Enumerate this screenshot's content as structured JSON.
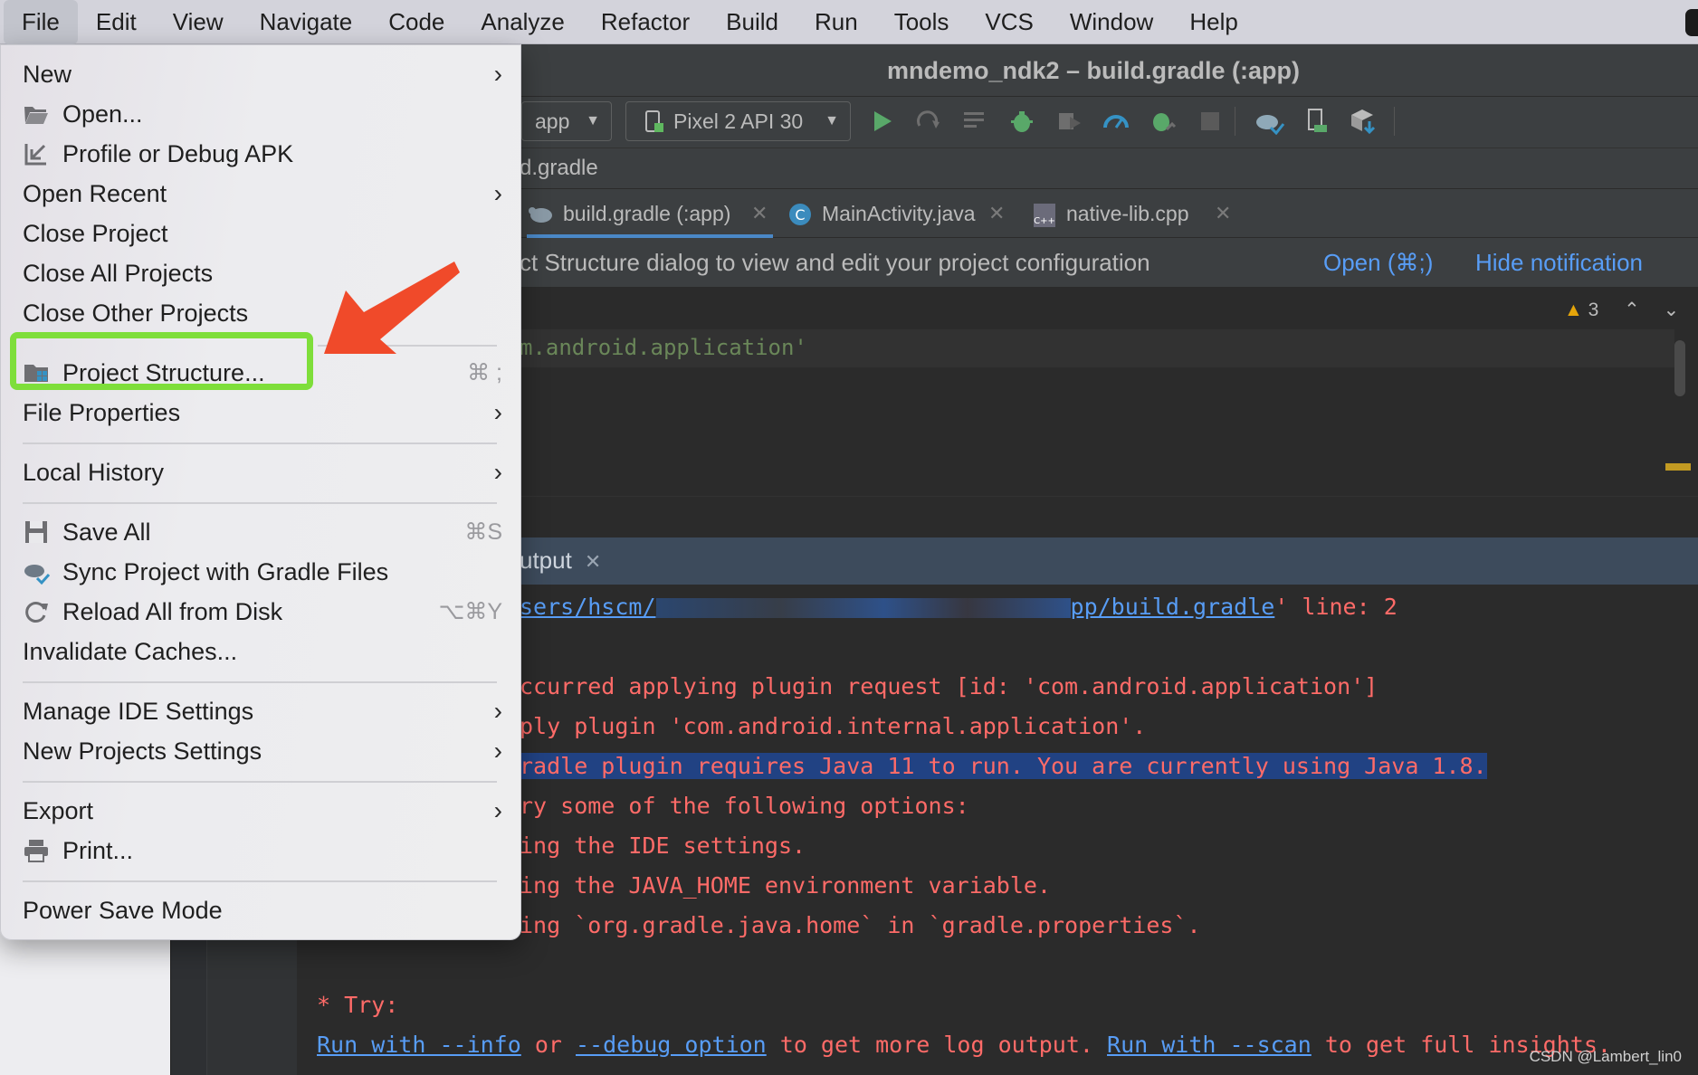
{
  "menubar": {
    "items": [
      "File",
      "Edit",
      "View",
      "Navigate",
      "Code",
      "Analyze",
      "Refactor",
      "Build",
      "Run",
      "Tools",
      "VCS",
      "Window",
      "Help"
    ]
  },
  "window": {
    "title": "mndemo_ndk2 – build.gradle (:app)"
  },
  "toolbar": {
    "module_config": "app",
    "device": "Pixel 2 API 30"
  },
  "navbar": {
    "path": "d.gradle"
  },
  "tabs": [
    {
      "label": "build.gradle (:app)",
      "active": true
    },
    {
      "label": "MainActivity.java",
      "active": false
    },
    {
      "label": "native-lib.cpp",
      "active": false
    }
  ],
  "notification": {
    "text": "ct Structure dialog to view and edit your project configuration",
    "open_link": "Open (⌘;)",
    "hide_link": "Hide notification"
  },
  "editor": {
    "code": "m.android.application'",
    "warning_count": "3"
  },
  "output": {
    "title": "utput",
    "lines": {
      "l1_link": "sers/hscm/",
      "l1_link2": "pp/build.gradle",
      "l1_tail": "' line: 2",
      "l2": "ccurred applying plugin request [id: 'com.android.application']",
      "l3": "ply plugin 'com.android.internal.application'.",
      "l4": "radle plugin requires Java 11 to run. You are currently using Java 1.8.",
      "l5": "ry some of the following options:",
      "l6": "ing the IDE settings.",
      "l7": "ing the JAVA_HOME environment variable.",
      "l8": "ing `org.gradle.java.home` in `gradle.properties`.",
      "try": "* Try:",
      "run_info": "Run with --info",
      "or": " or ",
      "debug_opt": "--debug option",
      "mid": " to get more log output. ",
      "run_scan": "Run with --scan",
      "end": " to get full insights."
    }
  },
  "watermark": "CSDN @Lambert_lin0",
  "file_menu": {
    "new": "New",
    "open": "Open...",
    "profile_debug": "Profile or Debug APK",
    "open_recent": "Open Recent",
    "close_project": "Close Project",
    "close_all": "Close All Projects",
    "close_other": "Close Other Projects",
    "project_structure": "Project Structure...",
    "project_structure_sc": "⌘ ;",
    "file_properties": "File Properties",
    "local_history": "Local History",
    "save_all": "Save All",
    "save_all_sc": "⌘S",
    "sync_gradle": "Sync Project with Gradle Files",
    "reload_disk": "Reload All from Disk",
    "reload_disk_sc": "⌥⌘Y",
    "invalidate": "Invalidate Caches...",
    "manage_ide": "Manage IDE Settings",
    "new_projects_settings": "New Projects Settings",
    "export": "Export",
    "print": "Print...",
    "power_save": "Power Save Mode"
  },
  "colors": {
    "highlight_box": "#7ede3a",
    "arrow": "#f04a2a",
    "console_error": "#ff6b68",
    "link": "#589df6"
  }
}
